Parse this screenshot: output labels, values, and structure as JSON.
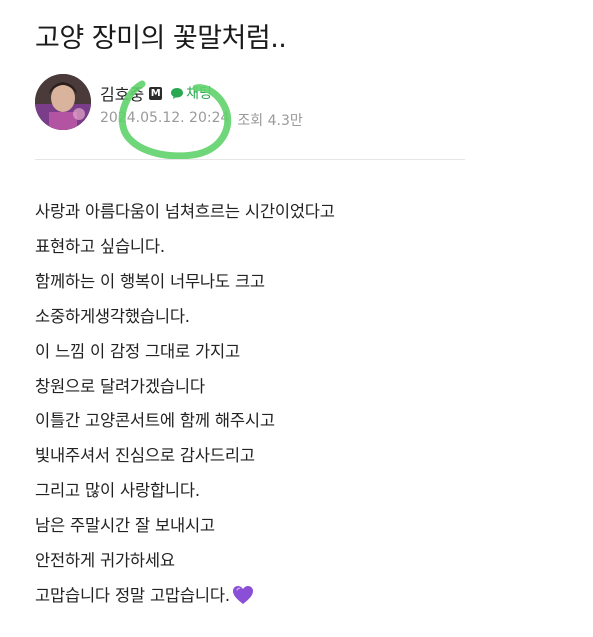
{
  "post": {
    "title": "고양 장미의 꽃말처럼..",
    "author": {
      "name": "김호중",
      "badge": "M",
      "chat_label": "채팅"
    },
    "meta": {
      "date": "2024.05.12. 20:24",
      "views": "조회 4.3만"
    },
    "body": {
      "lines": [
        "사랑과 아름다움이 넘쳐흐르는 시간이었다고",
        "표현하고 싶습니다.",
        "함께하는 이 행복이 너무나도 크고",
        "소중하게생각했습니다.",
        "이 느낌 이 감정 그대로 가지고",
        "창원으로 달려가겠습니다",
        "이틀간 고양콘서트에 함께 해주시고",
        "빛내주셔서 진심으로 감사드리고",
        "그리고 많이 사랑합니다.",
        "남은 주말시간 잘 보내시고",
        "안전하게 귀가하세요",
        "고맙습니다 정말 고맙습니다."
      ],
      "trailing_emoji": "purple-heart"
    }
  },
  "colors": {
    "chat_green": "#2aa851",
    "scribble_green": "#5fd26a",
    "heart_purple": "#8a4fd6",
    "meta_gray": "#9a9a9a"
  }
}
